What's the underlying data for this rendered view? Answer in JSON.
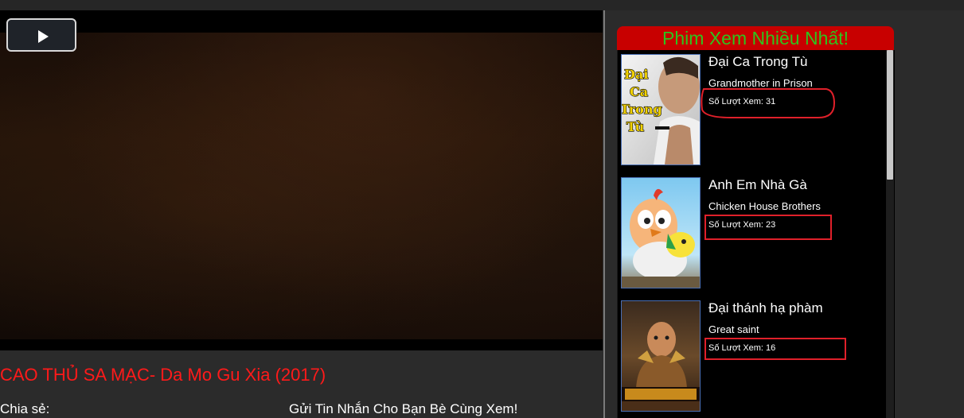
{
  "player": {
    "play_icon": "play-icon"
  },
  "movie": {
    "title": "CAO THỦ SA MẠC- Da Mo Gu Xia (2017)",
    "share_label": "Chia sẻ:",
    "send_message": "Gửi Tin Nhắn Cho Bạn Bè Cùng Xem!"
  },
  "sidebar": {
    "header": "Phim Xem Nhiều Nhất!",
    "items": [
      {
        "title": "Đại Ca Trong Tù",
        "subtitle": "Grandmother in Prison",
        "views": "Số Lượt Xem: 31",
        "poster_text": [
          "Đại",
          "Ca",
          "Trong",
          "Tù"
        ]
      },
      {
        "title": "Anh Em Nhà Gà",
        "subtitle": "Chicken House Brothers",
        "views": "Số Lượt Xem: 23"
      },
      {
        "title": "Đại thánh hạ phàm",
        "subtitle": "Great saint",
        "views": "Số Lượt Xem: 16"
      }
    ]
  },
  "colors": {
    "title_red": "#ff1a1a",
    "header_bg": "#c80000",
    "header_text": "#2ec41e",
    "highlight_box": "#e0202a"
  }
}
